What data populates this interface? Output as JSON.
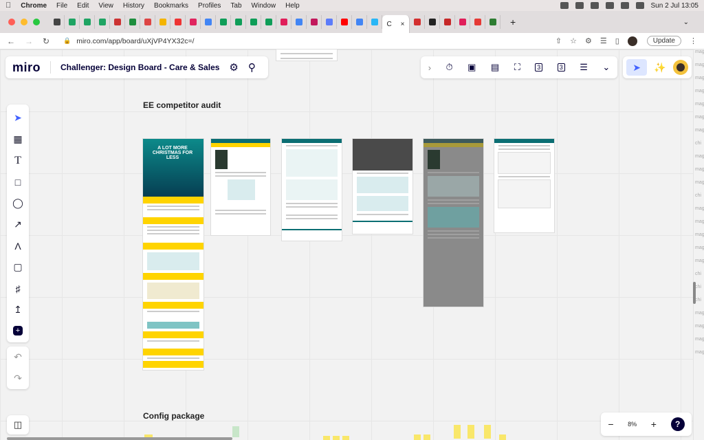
{
  "menubar": {
    "apple": "",
    "app": "Chrome",
    "items": [
      "File",
      "Edit",
      "View",
      "History",
      "Bookmarks",
      "Profiles",
      "Tab",
      "Window",
      "Help"
    ],
    "datetime": "Sun 2 Jul  13:05"
  },
  "tabs": {
    "active_label": "C",
    "active_close": "×",
    "new_tab": "+",
    "more": "⌄"
  },
  "address": {
    "url": "miro.com/app/board/uXjVP4YX32c=/",
    "update_label": "Update"
  },
  "board": {
    "logo": "miro",
    "title": "Challenger: Design Board - Care & Sales",
    "section1": "EE competitor audit",
    "section2": "Config package",
    "hero_text": "A LOT MORE CHRISTMAS FOR LESS",
    "zoom_value": "8%",
    "zoom_minus": "−",
    "zoom_plus": "+",
    "help": "?",
    "counter_a": "3",
    "counter_b": "3",
    "right_edge": [
      "mag",
      "mag",
      "mag",
      "mag",
      "mag",
      "mag",
      "mag",
      "chi",
      "mag",
      "mag",
      "mag",
      "chi",
      "mag",
      "mag",
      "mag",
      "mag",
      "mag",
      "chi",
      "chi",
      "chi",
      "mag",
      "mag",
      "mag",
      "mag"
    ]
  },
  "colors": {
    "accent": "#4262ff",
    "brand_dark": "#050038",
    "teal": "#0b6e73",
    "yellow": "#ffd400"
  }
}
